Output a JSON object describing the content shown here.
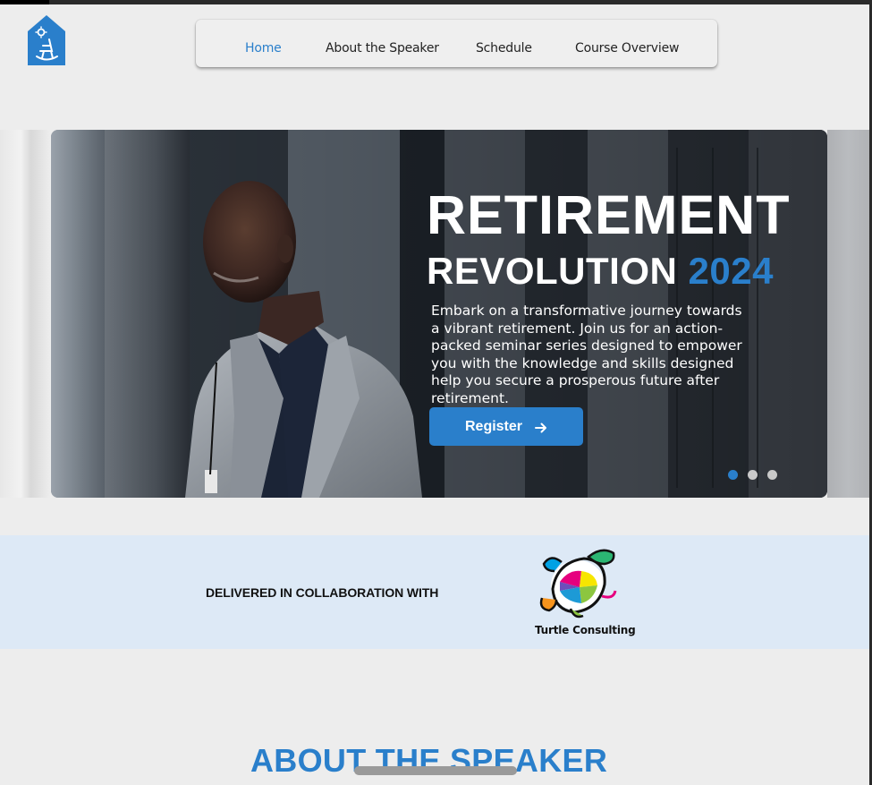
{
  "nav": {
    "items": [
      {
        "label": "Home",
        "active": true
      },
      {
        "label": "About the Speaker",
        "active": false
      },
      {
        "label": "Schedule",
        "active": false
      },
      {
        "label": "Course Overview",
        "active": false
      }
    ]
  },
  "logo": {
    "icon": "rocking-chair-house-icon"
  },
  "hero": {
    "title_line1": "RETIREMENT",
    "title_line2_word": "REVOLUTION",
    "title_line2_year": "2024",
    "description": "Embark on a transformative journey towards a vibrant retirement. Join us for an action-packed seminar series designed to empower you with the knowledge and skills designed help you secure a prosperous future after retirement.",
    "register_label": "Register",
    "register_icon": "arrow-right-icon",
    "carousel_active_index": 0,
    "carousel_count": 3
  },
  "collaboration": {
    "label": "DELIVERED IN COLLABORATION WITH",
    "partner_name": "Turtle Consulting"
  },
  "about": {
    "heading": "ABOUT THE SPEAKER"
  },
  "colors": {
    "accent": "#2a7fcb",
    "page_bg": "#ededed",
    "collab_bg": "#dde9f6"
  }
}
